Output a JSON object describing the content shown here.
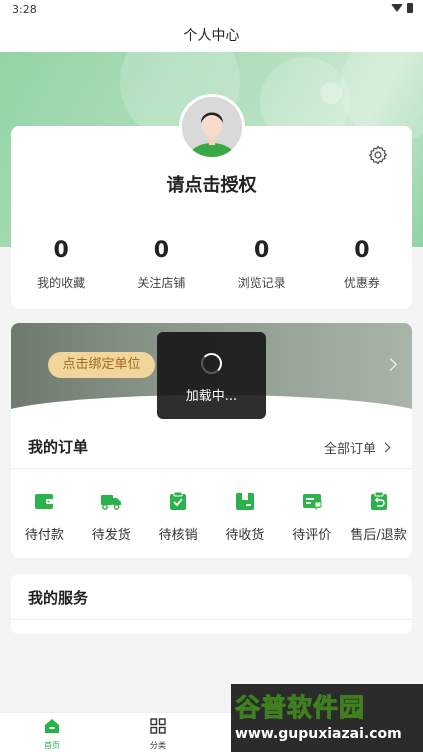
{
  "status_bar": {
    "time": "3:28"
  },
  "header": {
    "title": "个人中心"
  },
  "profile": {
    "auth_prompt": "请点击授权",
    "stats": [
      {
        "value": "0",
        "label": "我的收藏"
      },
      {
        "value": "0",
        "label": "关注店铺"
      },
      {
        "value": "0",
        "label": "浏览记录"
      },
      {
        "value": "0",
        "label": "优惠券"
      }
    ]
  },
  "bind": {
    "button_label": "点击绑定单位"
  },
  "loading": {
    "text": "加载中..."
  },
  "orders": {
    "title": "我的订单",
    "all_label": "全部订单",
    "items": [
      {
        "label": "待付款",
        "icon": "wallet-icon"
      },
      {
        "label": "待发货",
        "icon": "truck-icon"
      },
      {
        "label": "待核销",
        "icon": "clipboard-check-icon"
      },
      {
        "label": "待收货",
        "icon": "package-icon"
      },
      {
        "label": "待评价",
        "icon": "review-icon"
      },
      {
        "label": "售后/退款",
        "icon": "refund-icon"
      }
    ]
  },
  "services": {
    "title": "我的服务"
  },
  "tabbar": {
    "items": [
      {
        "label": "首页",
        "icon": "home-icon",
        "active": true
      },
      {
        "label": "分类",
        "icon": "category-grid-icon",
        "active": false
      }
    ]
  },
  "watermark": {
    "line1": "谷普软件园",
    "line2": "www.gupuxiazai.com"
  },
  "colors": {
    "accent": "#2cb24a",
    "banner": "#a8dcb6",
    "bind_button": "#f1d59a"
  }
}
